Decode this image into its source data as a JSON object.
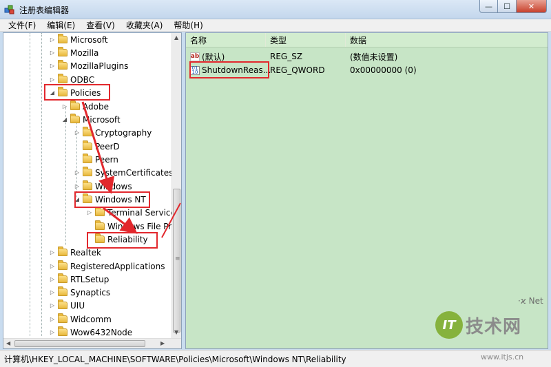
{
  "window": {
    "title": "注册表编辑器",
    "min_label": "—",
    "max_label": "☐",
    "close_label": "✕"
  },
  "menu": [
    "文件(F)",
    "编辑(E)",
    "查看(V)",
    "收藏夹(A)",
    "帮助(H)"
  ],
  "tree": {
    "items": [
      {
        "label": "Microsoft",
        "level": 0,
        "expander": "▷"
      },
      {
        "label": "Mozilla",
        "level": 0,
        "expander": "▷"
      },
      {
        "label": "MozillaPlugins",
        "level": 0,
        "expander": "▷"
      },
      {
        "label": "ODBC",
        "level": 0,
        "expander": "▷"
      },
      {
        "label": "Policies",
        "level": 0,
        "expander": "◢"
      },
      {
        "label": "Adobe",
        "level": 1,
        "expander": "▷"
      },
      {
        "label": "Microsoft",
        "level": 1,
        "expander": "◢"
      },
      {
        "label": "Cryptography",
        "level": 2,
        "expander": "▷"
      },
      {
        "label": "PeerD",
        "level": 2,
        "expander": ""
      },
      {
        "label": "Peern",
        "level": 2,
        "expander": ""
      },
      {
        "label": "SystemCertificates",
        "level": 2,
        "expander": "▷"
      },
      {
        "label": "Windows",
        "level": 2,
        "expander": "▷"
      },
      {
        "label": "Windows NT",
        "level": 2,
        "expander": "◢"
      },
      {
        "label": "Terminal Service",
        "level": 3,
        "expander": "▷"
      },
      {
        "label": "Windows File Pr",
        "level": 3,
        "expander": ""
      },
      {
        "label": "Reliability",
        "level": 3,
        "expander": ""
      },
      {
        "label": "Realtek",
        "level": 0,
        "expander": "▷"
      },
      {
        "label": "RegisteredApplications",
        "level": 0,
        "expander": "▷"
      },
      {
        "label": "RTLSetup",
        "level": 0,
        "expander": "▷"
      },
      {
        "label": "Synaptics",
        "level": 0,
        "expander": "▷"
      },
      {
        "label": "UIU",
        "level": 0,
        "expander": "▷"
      },
      {
        "label": "Widcomm",
        "level": 0,
        "expander": "▷"
      },
      {
        "label": "Wow6432Node",
        "level": 0,
        "expander": "▷"
      }
    ]
  },
  "values": {
    "columns": [
      "名称",
      "类型",
      "数据"
    ],
    "rows": [
      {
        "name": "(默认)",
        "type": "REG_SZ",
        "data": "(数值未设置)",
        "icon": "ab-icon"
      },
      {
        "name": "ShutdownReas...",
        "type": "REG_QWORD",
        "data": "0x00000000 (0)",
        "icon": "binary-value-icon"
      }
    ]
  },
  "status": {
    "path": "计算机\\HKEY_LOCAL_MACHINE\\SOFTWARE\\Policies\\Microsoft\\Windows NT\\Reliability"
  },
  "watermark": {
    "badge": "IT",
    "brand": "技术网",
    "url": "www.itjs.cn",
    "top_text": "·ϰ Net"
  },
  "colors": {
    "highlight": "#e2282d",
    "value_pane_bg": "#c7e5c6"
  }
}
